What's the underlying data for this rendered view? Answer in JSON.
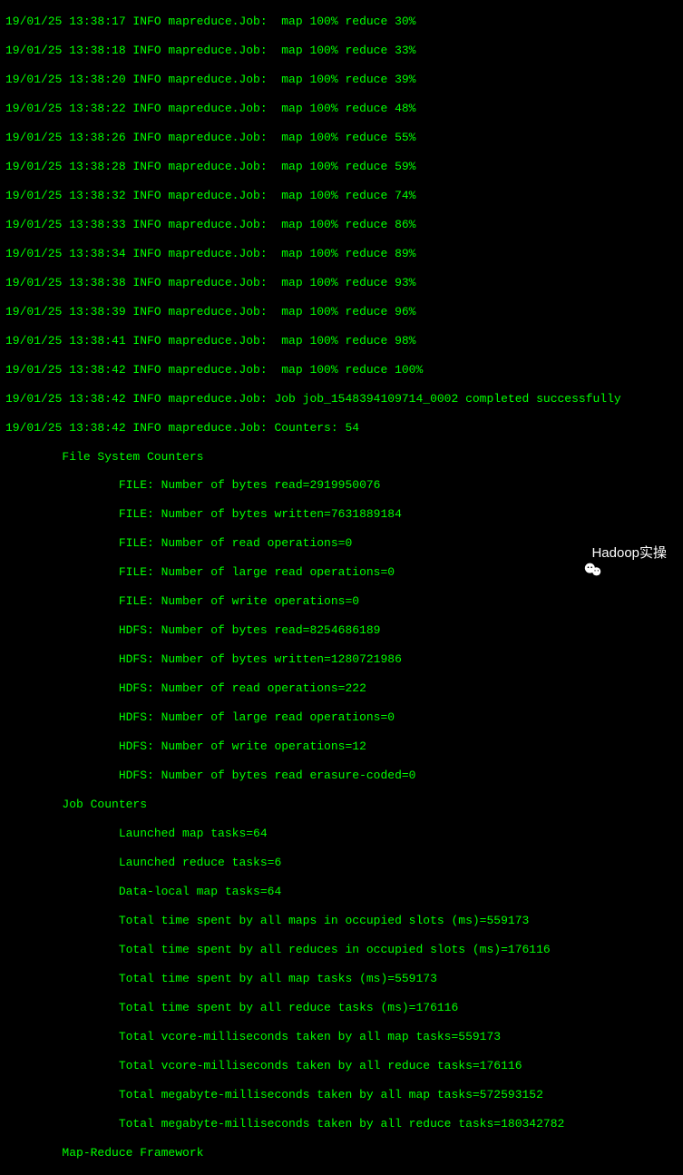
{
  "progress_lines": [
    {
      "ts": "19/01/25 13:38:17",
      "level": "INFO",
      "src": "mapreduce.Job",
      "msg": " map 100% reduce 30%"
    },
    {
      "ts": "19/01/25 13:38:18",
      "level": "INFO",
      "src": "mapreduce.Job",
      "msg": " map 100% reduce 33%"
    },
    {
      "ts": "19/01/25 13:38:20",
      "level": "INFO",
      "src": "mapreduce.Job",
      "msg": " map 100% reduce 39%"
    },
    {
      "ts": "19/01/25 13:38:22",
      "level": "INFO",
      "src": "mapreduce.Job",
      "msg": " map 100% reduce 48%"
    },
    {
      "ts": "19/01/25 13:38:26",
      "level": "INFO",
      "src": "mapreduce.Job",
      "msg": " map 100% reduce 55%"
    },
    {
      "ts": "19/01/25 13:38:28",
      "level": "INFO",
      "src": "mapreduce.Job",
      "msg": " map 100% reduce 59%"
    },
    {
      "ts": "19/01/25 13:38:32",
      "level": "INFO",
      "src": "mapreduce.Job",
      "msg": " map 100% reduce 74%"
    },
    {
      "ts": "19/01/25 13:38:33",
      "level": "INFO",
      "src": "mapreduce.Job",
      "msg": " map 100% reduce 86%"
    },
    {
      "ts": "19/01/25 13:38:34",
      "level": "INFO",
      "src": "mapreduce.Job",
      "msg": " map 100% reduce 89%"
    },
    {
      "ts": "19/01/25 13:38:38",
      "level": "INFO",
      "src": "mapreduce.Job",
      "msg": " map 100% reduce 93%"
    },
    {
      "ts": "19/01/25 13:38:39",
      "level": "INFO",
      "src": "mapreduce.Job",
      "msg": " map 100% reduce 96%"
    },
    {
      "ts": "19/01/25 13:38:41",
      "level": "INFO",
      "src": "mapreduce.Job",
      "msg": " map 100% reduce 98%"
    },
    {
      "ts": "19/01/25 13:38:42",
      "level": "INFO",
      "src": "mapreduce.Job",
      "msg": " map 100% reduce 100%"
    },
    {
      "ts": "19/01/25 13:38:42",
      "level": "INFO",
      "src": "mapreduce.Job",
      "msg": "Job job_1548394109714_0002 completed successfully"
    },
    {
      "ts": "19/01/25 13:38:42",
      "level": "INFO",
      "src": "mapreduce.Job",
      "msg": "Counters: 54"
    }
  ],
  "counters": {
    "fs_header": "        File System Counters",
    "fs": [
      "                FILE: Number of bytes read=2919950076",
      "                FILE: Number of bytes written=7631889184",
      "                FILE: Number of read operations=0",
      "                FILE: Number of large read operations=0",
      "                FILE: Number of write operations=0",
      "                HDFS: Number of bytes read=8254686189",
      "                HDFS: Number of bytes written=1280721986",
      "                HDFS: Number of read operations=222",
      "                HDFS: Number of large read operations=0",
      "                HDFS: Number of write operations=12",
      "                HDFS: Number of bytes read erasure-coded=0"
    ],
    "job_header": "        Job Counters",
    "job": [
      "                Launched map tasks=64",
      "                Launched reduce tasks=6",
      "                Data-local map tasks=64",
      "                Total time spent by all maps in occupied slots (ms)=559173",
      "                Total time spent by all reduces in occupied slots (ms)=176116",
      "                Total time spent by all map tasks (ms)=559173",
      "                Total time spent by all reduce tasks (ms)=176116",
      "                Total vcore-milliseconds taken by all map tasks=559173",
      "                Total vcore-milliseconds taken by all reduce tasks=176116",
      "                Total megabyte-milliseconds taken by all map tasks=572593152",
      "                Total megabyte-milliseconds taken by all reduce tasks=180342782"
    ],
    "mr_header": "        Map-Reduce Framework"
  },
  "watermark": {
    "text": "Hadoop实操"
  }
}
